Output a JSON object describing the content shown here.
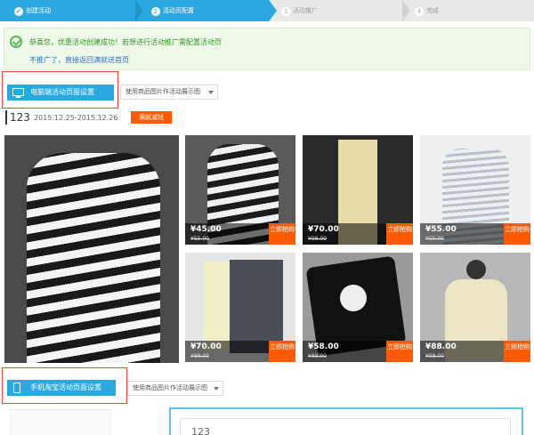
{
  "steps": [
    {
      "num": "1",
      "label": "创建活动"
    },
    {
      "num": "2",
      "label": "活动页配置"
    },
    {
      "num": "3",
      "label": "活动推广"
    },
    {
      "num": "4",
      "label": "完成"
    }
  ],
  "notice": {
    "message": "恭喜您，优惠活动创建成功！若想进行活动推广需配置活动页",
    "link": "不推广了，直接返回满就送首页"
  },
  "pc_section": {
    "title": "电脑端活动页面设置",
    "dropdown": "使用商品图片作活动展示图"
  },
  "activity": {
    "title": "123",
    "dates": "2015.12.25-2015.12.26",
    "badge": "满就减钱"
  },
  "products": [
    {
      "price": "¥45.00",
      "old_price": "¥55.00",
      "buy": "立即抢购"
    },
    {
      "price": "¥70.00",
      "old_price": "¥98.00",
      "buy": "立即抢购"
    },
    {
      "price": "¥55.00",
      "old_price": "¥55.00",
      "buy": "立即抢购"
    },
    {
      "price": "¥70.00",
      "old_price": "¥88.00",
      "buy": "立即抢购"
    },
    {
      "price": "¥58.00",
      "old_price": "¥68.00",
      "buy": "立即抢购"
    },
    {
      "price": "¥88.00",
      "old_price": "¥98.00",
      "buy": "立即抢购"
    }
  ],
  "mobile_section": {
    "title": "手机淘宝活动页面设置",
    "dropdown": "使用商品图片作活动展示图",
    "preview_title": "123"
  }
}
